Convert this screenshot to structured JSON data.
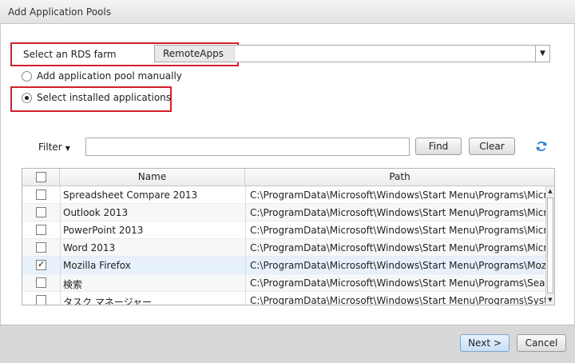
{
  "window": {
    "title": "Add Application Pools"
  },
  "farm": {
    "label": "Select an RDS farm",
    "value": "RemoteApps"
  },
  "options": [
    {
      "label": "Add application pool manually",
      "selected": false
    },
    {
      "label": "Select installed applications",
      "selected": true
    }
  ],
  "filter": {
    "label": "Filter",
    "value": "",
    "find_label": "Find",
    "clear_label": "Clear"
  },
  "table": {
    "headers": {
      "name": "Name",
      "path": "Path"
    },
    "rows": [
      {
        "name": "Spreadsheet Compare 2013",
        "path": "C:\\ProgramData\\Microsoft\\Windows\\Start Menu\\Programs\\Micro",
        "checked": false
      },
      {
        "name": "Outlook 2013",
        "path": "C:\\ProgramData\\Microsoft\\Windows\\Start Menu\\Programs\\Micro",
        "checked": false
      },
      {
        "name": "PowerPoint 2013",
        "path": "C:\\ProgramData\\Microsoft\\Windows\\Start Menu\\Programs\\Micro",
        "checked": false
      },
      {
        "name": "Word 2013",
        "path": "C:\\ProgramData\\Microsoft\\Windows\\Start Menu\\Programs\\Micro",
        "checked": false
      },
      {
        "name": "Mozilla Firefox",
        "path": "C:\\ProgramData\\Microsoft\\Windows\\Start Menu\\Programs\\Mozill",
        "checked": true
      },
      {
        "name": "検索",
        "path": "C:\\ProgramData\\Microsoft\\Windows\\Start Menu\\Programs\\Searc",
        "checked": false
      },
      {
        "name": "タスク マネージャー",
        "path": "C:\\ProgramData\\Microsoft\\Windows\\Start Menu\\Programs\\Syste",
        "checked": false
      }
    ]
  },
  "footer": {
    "next_label": "Next >",
    "cancel_label": "Cancel"
  },
  "colors": {
    "highlight": "#d2202e",
    "selected_row": "#e6f1fb"
  }
}
